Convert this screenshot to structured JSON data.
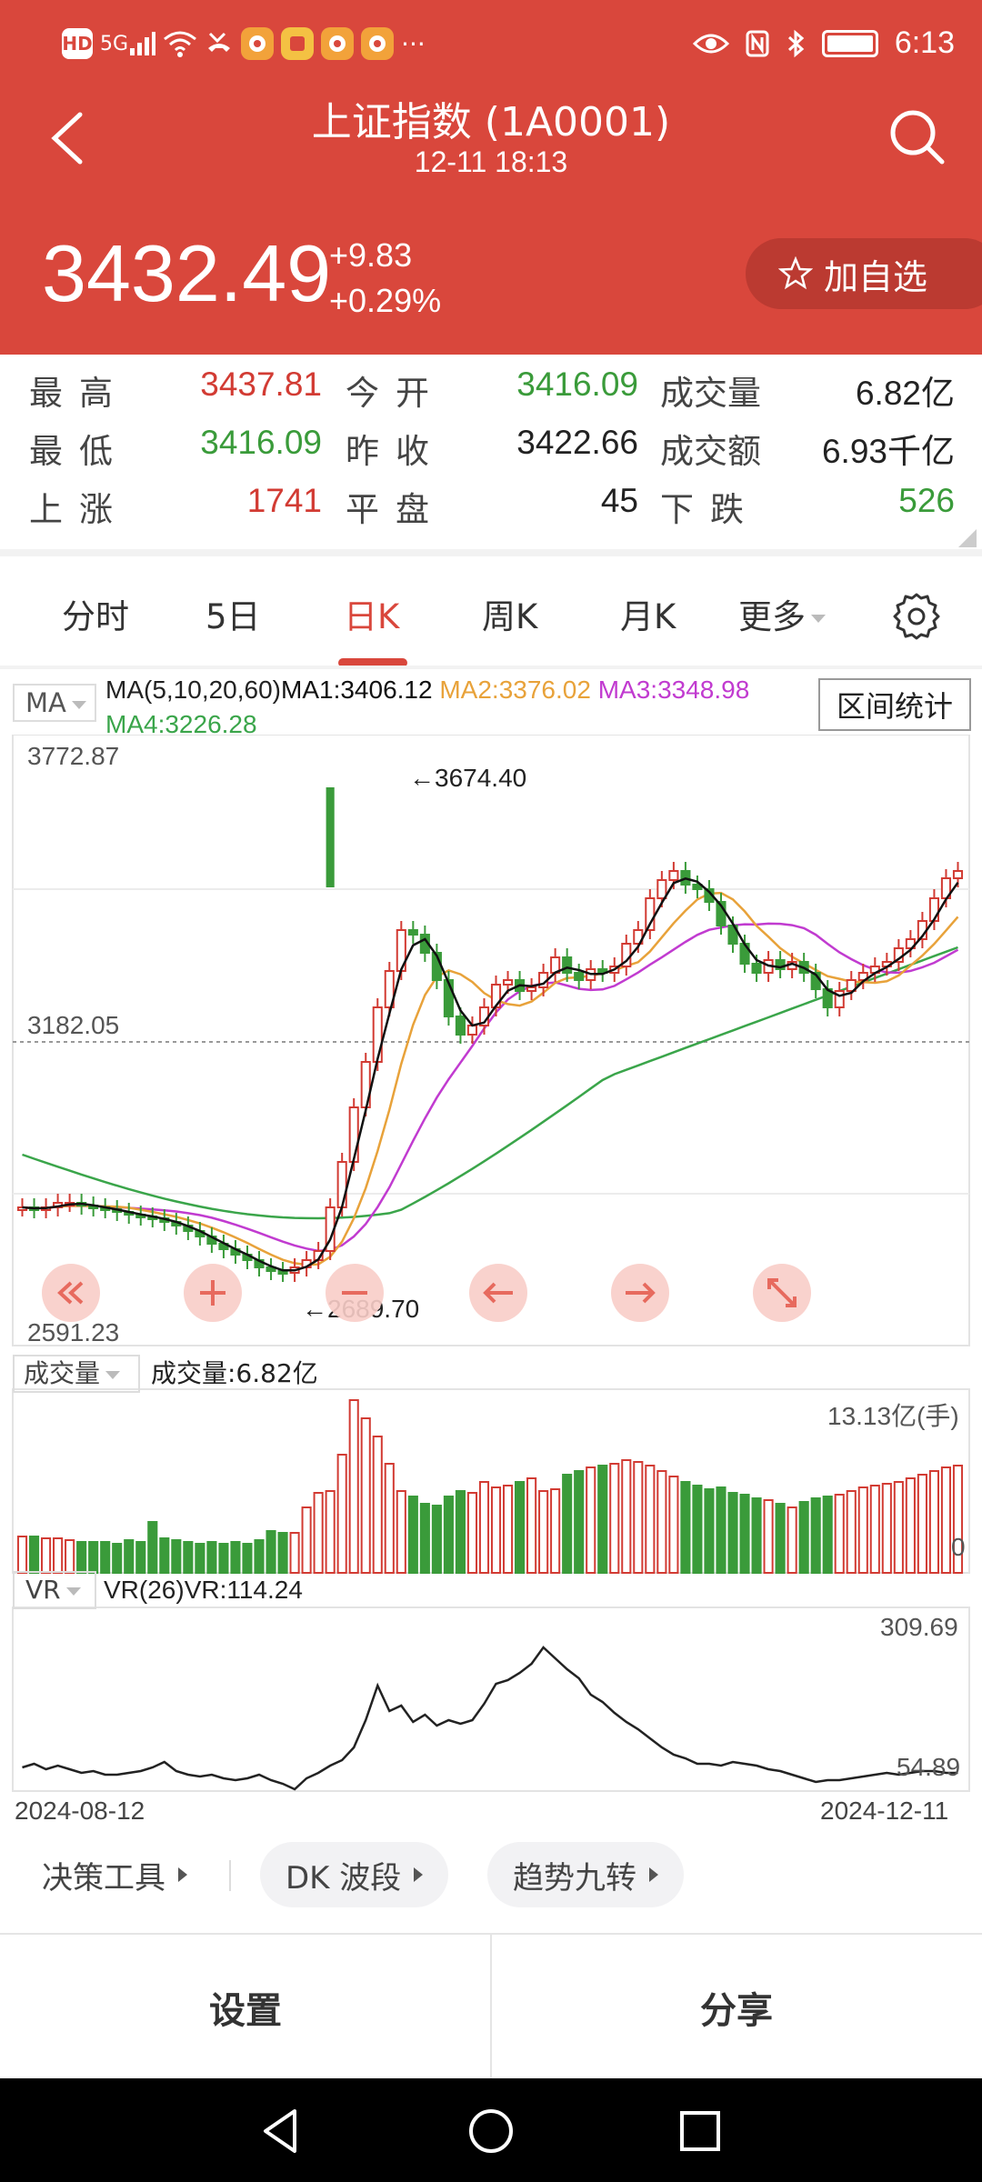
{
  "status_bar": {
    "hd": "HD",
    "network": "5G",
    "time": "6:13",
    "more": "···"
  },
  "header": {
    "title": "上证指数 (1A0001)",
    "subtitle": "12-11 18:13",
    "price": "3432.49",
    "change_abs": "+9.83",
    "change_pct": "+0.29%",
    "watch_label": "加自选",
    "back_icon": "chevron-left-icon",
    "search_icon": "search-icon",
    "bg_color": "#d9473c"
  },
  "stats": {
    "high_label": "最高",
    "high_value": "3437.81",
    "open_label": "今开",
    "open_value": "3416.09",
    "volume_label": "成交量",
    "volume_value": "6.82亿",
    "low_label": "最低",
    "low_value": "3416.09",
    "prev_close_label": "昨收",
    "prev_close_value": "3422.66",
    "amount_label": "成交额",
    "amount_value": "6.93千亿",
    "up_label": "上涨",
    "up_value": "1741",
    "flat_label": "平盘",
    "flat_value": "45",
    "down_label": "下跌",
    "down_value": "526"
  },
  "tabs": [
    "分时",
    "5日",
    "日K",
    "周K",
    "月K",
    "更多"
  ],
  "active_tab": "日K",
  "ma": {
    "select_label": "MA",
    "params": "MA(5,10,20,60)",
    "ma1": "MA1:3406.12",
    "ma2": "MA2:3376.02",
    "ma3": "MA3:3348.98",
    "ma4": "MA4:3226.28",
    "colors": {
      "ma1": "#111111",
      "ma2": "#e8a23a",
      "ma3": "#c13bd0",
      "ma4": "#3aa54a"
    },
    "range_button": "区间统计"
  },
  "kline": {
    "y_max": "3772.87",
    "y_mid": "3182.05",
    "y_min": "2591.23",
    "high_marker": "←3674.40",
    "low_marker": "←2689.70"
  },
  "volume": {
    "select_label": "成交量",
    "label": "成交量:6.82亿",
    "max_label": "13.13亿(手)",
    "min_label": "0"
  },
  "vr": {
    "select_label": "VR",
    "label": "VR(26)VR:114.24",
    "max_label": "309.69",
    "min_label": "54.89"
  },
  "dates": {
    "start": "2024-08-12",
    "end": "2024-12-11"
  },
  "tools": [
    {
      "label": "决策工具"
    },
    {
      "label": "DK 波段"
    },
    {
      "label": "趋势九转"
    }
  ],
  "bottom": {
    "settings": "设置",
    "share": "分享"
  }
}
